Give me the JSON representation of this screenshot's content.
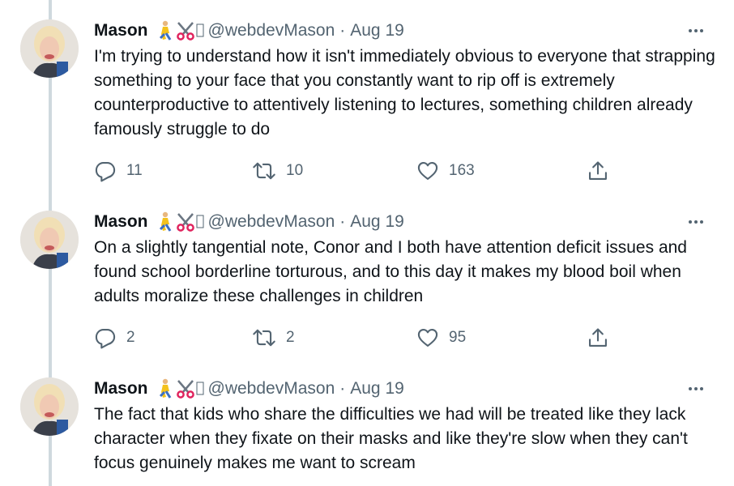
{
  "tweets": [
    {
      "author_name": "Mason",
      "handle": "@webdevMason",
      "separator": "·",
      "date": "Aug 19",
      "text": "I'm trying to understand how it isn't immediately obvious to everyone that strapping something to your face that you constantly want to rip off is extremely counterproductive to attentively listening to lectures, something children already famously struggle to do",
      "replies": "11",
      "retweets": "10",
      "likes": "163"
    },
    {
      "author_name": "Mason",
      "handle": "@webdevMason",
      "separator": "·",
      "date": "Aug 19",
      "text": "On a slightly tangential note, Conor and I both have attention deficit issues and found school borderline torturous, and to this day it makes my blood boil when adults moralize these challenges in children",
      "replies": "2",
      "retweets": "2",
      "likes": "95"
    },
    {
      "author_name": "Mason",
      "handle": "@webdevMason",
      "separator": "·",
      "date": "Aug 19",
      "text": "The fact that kids who share the difficulties we had will be treated like they lack character when they fixate on their masks and like they're slow when they can't focus genuinely makes me want to scream"
    }
  ],
  "icons": {
    "name_emojis": [
      "person-kneeling-icon",
      "scissors-icon",
      "missing-glyph-icon"
    ],
    "more": "more-options-icon",
    "reply": "reply-icon",
    "retweet": "retweet-icon",
    "like": "heart-icon",
    "share": "share-icon"
  },
  "colors": {
    "text": "#0f1419",
    "secondary": "#536471",
    "thread_line": "#cfd9de",
    "background": "#ffffff"
  }
}
